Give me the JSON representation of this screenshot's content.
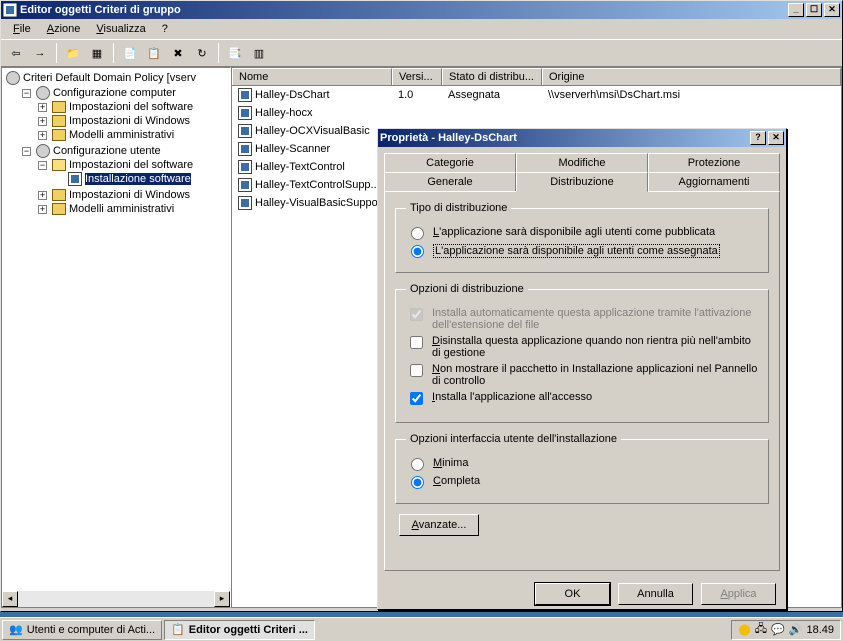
{
  "window": {
    "title": "Editor oggetti Criteri di gruppo"
  },
  "menu": {
    "file": "File",
    "azione": "Azione",
    "visualizza": "Visualizza",
    "help": "?"
  },
  "tree": {
    "root": "Criteri Default Domain Policy [vserv",
    "computer_config": "Configurazione computer",
    "software_settings1": "Impostazioni del software",
    "windows_settings1": "Impostazioni di Windows",
    "admin_templates1": "Modelli amministrativi",
    "user_config": "Configurazione utente",
    "software_settings2": "Impostazioni del software",
    "software_install": "Installazione software",
    "windows_settings2": "Impostazioni di Windows",
    "admin_templates2": "Modelli amministrativi"
  },
  "list": {
    "columns": {
      "name": "Nome",
      "version": "Versi...",
      "state": "Stato di distribu...",
      "origin": "Origine"
    },
    "items": [
      {
        "name": "Halley-DsChart",
        "version": "1.0",
        "state": "Assegnata",
        "origin": "\\\\vserverh\\msi\\DsChart.msi"
      },
      {
        "name": "Halley-hocx",
        "version": "",
        "state": "",
        "origin": ""
      },
      {
        "name": "Halley-OCXVisualBasic",
        "version": "",
        "state": "",
        "origin": ""
      },
      {
        "name": "Halley-Scanner",
        "version": "",
        "state": "",
        "origin": ""
      },
      {
        "name": "Halley-TextControl",
        "version": "",
        "state": "",
        "origin": ""
      },
      {
        "name": "Halley-TextControlSupp...",
        "version": "",
        "state": "",
        "origin": ""
      },
      {
        "name": "Halley-VisualBasicSupport",
        "version": "",
        "state": "",
        "origin": ""
      }
    ]
  },
  "dialog": {
    "title": "Proprietà - Halley-DsChart",
    "tabs": {
      "categorie": "Categorie",
      "modifiche": "Modifiche",
      "protezione": "Protezione",
      "generale": "Generale",
      "distribuzione": "Distribuzione",
      "aggiornamenti": "Aggiornamenti"
    },
    "group_dist_type": "Tipo di distribuzione",
    "radio_published": "L'applicazione sarà disponibile agli utenti come pubblicata",
    "radio_assigned": "L'applicazione sarà disponibile agli utenti come assegnata",
    "group_dist_opts": "Opzioni di distribuzione",
    "chk_auto": "Installa automaticamente questa applicazione tramite l'attivazione dell'estensione del file",
    "chk_uninstall": "Disinstalla questa applicazione quando non rientra più nell'ambito di gestione",
    "chk_hide": "Non mostrare il pacchetto in Installazione applicazioni nel Pannello di controllo",
    "chk_logon": "Installa l'applicazione all'accesso",
    "group_ui": "Opzioni interfaccia utente dell'installazione",
    "radio_minimal": "Minima",
    "radio_full": "Completa",
    "btn_advanced": "Avanzate...",
    "btn_ok": "OK",
    "btn_cancel": "Annulla",
    "btn_apply": "Applica"
  },
  "taskbar": {
    "task1": "Utenti e computer di Acti...",
    "task2": "Editor oggetti Criteri ...",
    "clock": "18.49"
  }
}
